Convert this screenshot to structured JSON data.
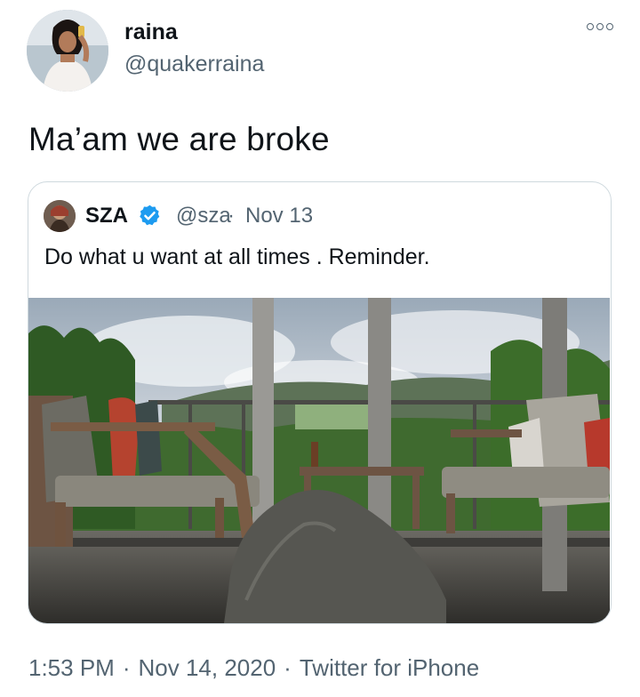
{
  "tweet": {
    "author_name": "raina",
    "author_handle": "@quakerraina",
    "text": "Ma’am we are broke",
    "more_icon": "more-options-icon"
  },
  "quoted_tweet": {
    "author_name": "SZA",
    "author_handle": "@sza",
    "separator": "·",
    "date": "Nov 13",
    "text": "Do what u want at all times . Reminder.",
    "verified_icon": "verified-badge-icon",
    "verified_color": "#1d9bf0"
  },
  "footer": {
    "time": "1:53 PM",
    "sep1": "·",
    "date": "Nov 14, 2020",
    "sep2": "·",
    "source": "Twitter for iPhone"
  },
  "colors": {
    "text": "#0f1419",
    "secondary": "#536471",
    "border": "#cfd9de"
  }
}
